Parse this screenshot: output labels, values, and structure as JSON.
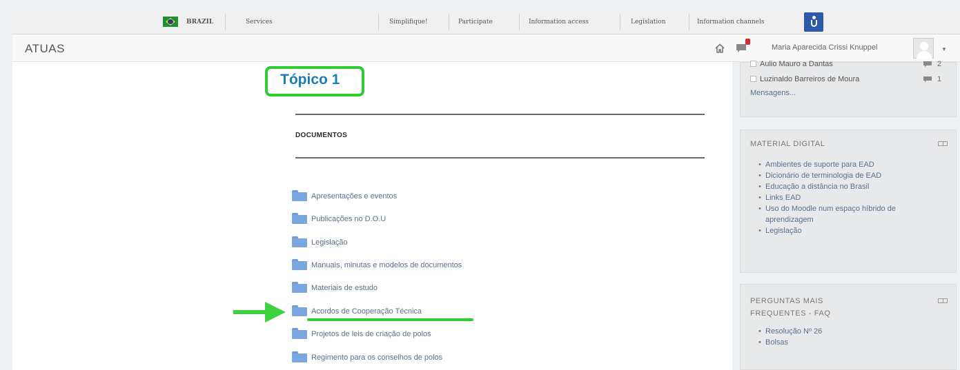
{
  "gov_bar": {
    "country": "BRAZIL",
    "items": [
      "Services",
      "Simplifique!",
      "Participate",
      "Information access",
      "Legislation",
      "Information channels"
    ]
  },
  "navbar": {
    "brand": "ATUAS",
    "notification_count": "",
    "user_name": "Maria Aparecida Crissi Knuppel"
  },
  "main": {
    "topic_title": "Tópico 1",
    "section_label": "DOCUMENTOS",
    "folders": [
      "Apresentações e eventos",
      "Publicações no D.O.U",
      "Legislação",
      "Manuais, minutas e modelos de documentos",
      "Materiais de estudo",
      "Acordos de Cooperação Técnica",
      "Projetos de leis de criação de polos",
      "Regimento para os conselhos de polos"
    ],
    "highlighted_folder_index": 5
  },
  "sidebar": {
    "contacts": [
      {
        "name": "Aulio Mauro a Dantas",
        "count": "2"
      },
      {
        "name": "Luzinaldo Barreiros de Moura",
        "count": "1"
      }
    ],
    "messages_link": "Mensagens...",
    "material_digital": {
      "title": "MATERIAL DIGITAL",
      "items": [
        "Ambientes de suporte para EAD",
        "Dicionário de terminologia de EAD",
        "Educação a distância no Brasil",
        "Links EAD",
        "Uso do Moodle num espaço híbrido de aprendizagem",
        "Legislação"
      ]
    },
    "faq": {
      "title_line1": "PERGUNTAS MAIS",
      "title_line2": "FREQUENTES - FAQ",
      "items": [
        "Resolução Nº 26",
        "Bolsas"
      ]
    }
  },
  "colors": {
    "highlight_green": "#2ecc2e",
    "title_blue": "#1a7db6",
    "link_blue": "#5a6f8f",
    "folder_blue": "#7aa7e0",
    "badge_red": "#d9272e"
  }
}
